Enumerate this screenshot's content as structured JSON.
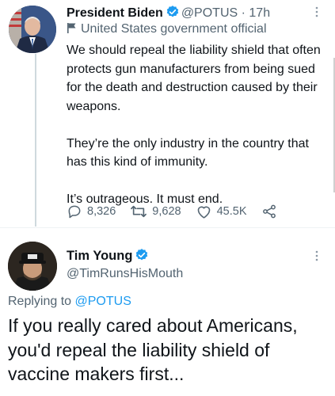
{
  "tweet": {
    "author_name": "President Biden",
    "handle": "@POTUS",
    "separator": "·",
    "time": "17h",
    "label": "United States government official",
    "paragraphs": [
      "We should repeal the liability shield that often protects gun manufacturers from being sued for the death and destruction caused by their weapons.",
      "They’re the only industry in the country that has this kind of immunity.",
      "It’s outrageous. It must end."
    ],
    "replies": "8,326",
    "retweets": "9,628",
    "likes": "45.5K"
  },
  "reply": {
    "author_name": "Tim Young",
    "handle": "@TimRunsHisMouth",
    "replying_prefix": "Replying to",
    "replying_to": "@POTUS",
    "text": "If you really cared about Americans, you'd repeal the liability shield of vaccine makers first..."
  },
  "colors": {
    "verified": "#1d9bf0",
    "link": "#1d9bf0",
    "muted": "#536471"
  },
  "icons": [
    "verified-badge-icon",
    "flag-icon",
    "more-icon",
    "reply-icon",
    "retweet-icon",
    "like-icon",
    "share-icon"
  ]
}
